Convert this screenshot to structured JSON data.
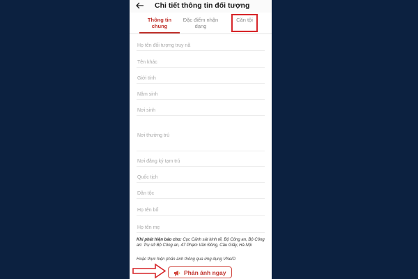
{
  "header": {
    "title": "Chi tiết thông tin đối tượng"
  },
  "tabs": [
    {
      "label_line1": "Thông tin",
      "label_line2": "chung"
    },
    {
      "label_line1": "Đặc điểm nhận",
      "label_line2": "dạng"
    },
    {
      "label_line1": "Căn tội",
      "label_line2": ""
    }
  ],
  "fields": [
    "Họ tên đối tượng truy nã",
    "Tên khác",
    "Giới tính",
    "Năm sinh",
    "Nơi sinh",
    "Nơi thường trú",
    "Nơi đăng ký tạm trú",
    "Quốc tịch",
    "Dân tộc",
    "Họ tên bố",
    "Họ tên mẹ"
  ],
  "notice": {
    "lead": "Khi phát hiện báo cho:",
    "body": " Cục Cảnh sát kinh tế, Bộ Công an, Bộ Công an: Trụ sở Bộ Công an, 47 Phạm Văn Đồng, Cầu Giấy, Hà Nội"
  },
  "alt_note": "Hoặc thực hiện phản ánh thông qua ứng dụng VNeID",
  "report_button": {
    "label": "Phản ánh ngay"
  },
  "colors": {
    "accent": "#c0312b",
    "highlight": "#d7262a",
    "background": "#0c2140"
  }
}
